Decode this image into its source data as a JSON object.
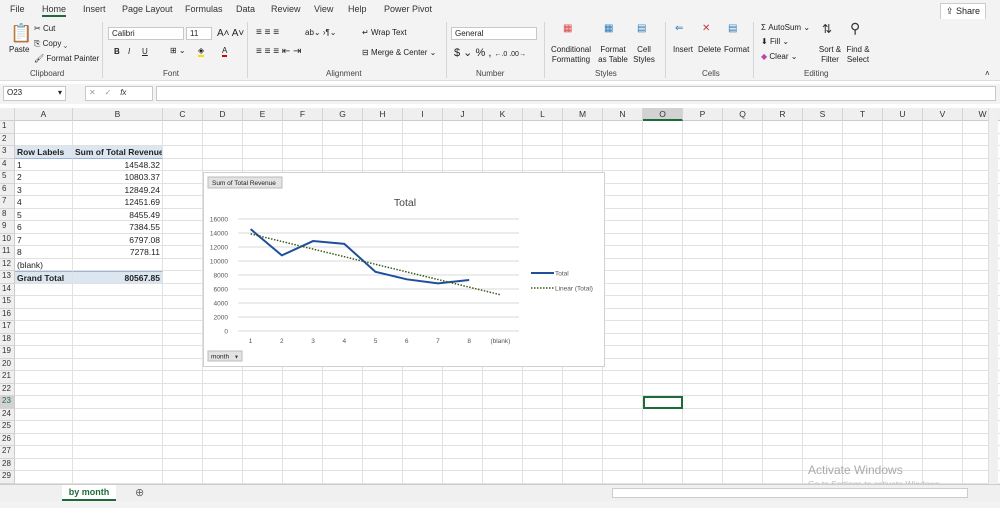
{
  "menu_tabs": [
    "File",
    "Home",
    "Insert",
    "Page Layout",
    "Formulas",
    "Data",
    "Review",
    "View",
    "Help",
    "Power Pivot"
  ],
  "active_tab": "Home",
  "share_label": "Share",
  "clipboard": {
    "paste": "Paste",
    "cut": "Cut",
    "copy": "Copy",
    "format_painter": "Format Painter",
    "group": "Clipboard"
  },
  "font": {
    "name": "Calibri",
    "size": "11",
    "bold": "B",
    "italic": "I",
    "underline": "U",
    "group": "Font"
  },
  "alignment": {
    "wrap": "Wrap Text",
    "merge": "Merge & Center",
    "group": "Alignment"
  },
  "number": {
    "format": "General",
    "currency": "$",
    "percent": "%",
    "comma": ",",
    "group": "Number"
  },
  "styles": {
    "conditional": "Conditional Formatting",
    "format_table": "Format as Table",
    "cell_styles": "Cell Styles",
    "group": "Styles"
  },
  "cells": {
    "insert": "Insert",
    "delete": "Delete",
    "format": "Format",
    "group": "Cells"
  },
  "editing": {
    "autosum": "AutoSum",
    "fill": "Fill",
    "clear": "Clear",
    "sort": "Sort & Filter",
    "find": "Find & Select",
    "group": "Editing"
  },
  "formula_bar": {
    "name_box": "O23",
    "fx": "fx",
    "value": ""
  },
  "columns": [
    "A",
    "B",
    "C",
    "D",
    "E",
    "F",
    "G",
    "H",
    "I",
    "J",
    "K",
    "L",
    "M",
    "N",
    "O",
    "P",
    "Q",
    "R",
    "S",
    "T",
    "U",
    "V",
    "W"
  ],
  "selected_cell": "O23",
  "pivot": {
    "header_labels": "Row Labels",
    "header_values": "Sum of Total Revenue",
    "rows": [
      {
        "label": "1",
        "value": "14548.32"
      },
      {
        "label": "2",
        "value": "10803.37"
      },
      {
        "label": "3",
        "value": "12849.24"
      },
      {
        "label": "4",
        "value": "12451.69"
      },
      {
        "label": "5",
        "value": "8455.49"
      },
      {
        "label": "6",
        "value": "7384.55"
      },
      {
        "label": "7",
        "value": "6797.08"
      },
      {
        "label": "8",
        "value": "7278.11"
      },
      {
        "label": "(blank)",
        "value": ""
      }
    ],
    "grand_total_label": "Grand Total",
    "grand_total": "80567.85"
  },
  "chart_data": {
    "type": "line",
    "title": "Total",
    "field_button": "Sum of Total Revenue",
    "axis_button": "month",
    "categories": [
      "1",
      "2",
      "3",
      "4",
      "5",
      "6",
      "7",
      "8",
      "(blank)"
    ],
    "series": [
      {
        "name": "Total",
        "values": [
          14548.32,
          10803.37,
          12849.24,
          12451.69,
          8455.49,
          7384.55,
          6797.08,
          7278.11,
          null
        ],
        "color": "#1f4e9c"
      },
      {
        "name": "Linear (Total)",
        "trendline": "linear",
        "color": "#3a5a1a"
      }
    ],
    "ylim": [
      0,
      16000
    ],
    "yticks": [
      0,
      2000,
      4000,
      6000,
      8000,
      10000,
      12000,
      14000,
      16000
    ],
    "grid": true,
    "legend": "right"
  },
  "sheet_tabs": [
    "by month"
  ],
  "watermark": {
    "line1": "Activate Windows",
    "line2": "Go to Settings to activate Windows."
  }
}
